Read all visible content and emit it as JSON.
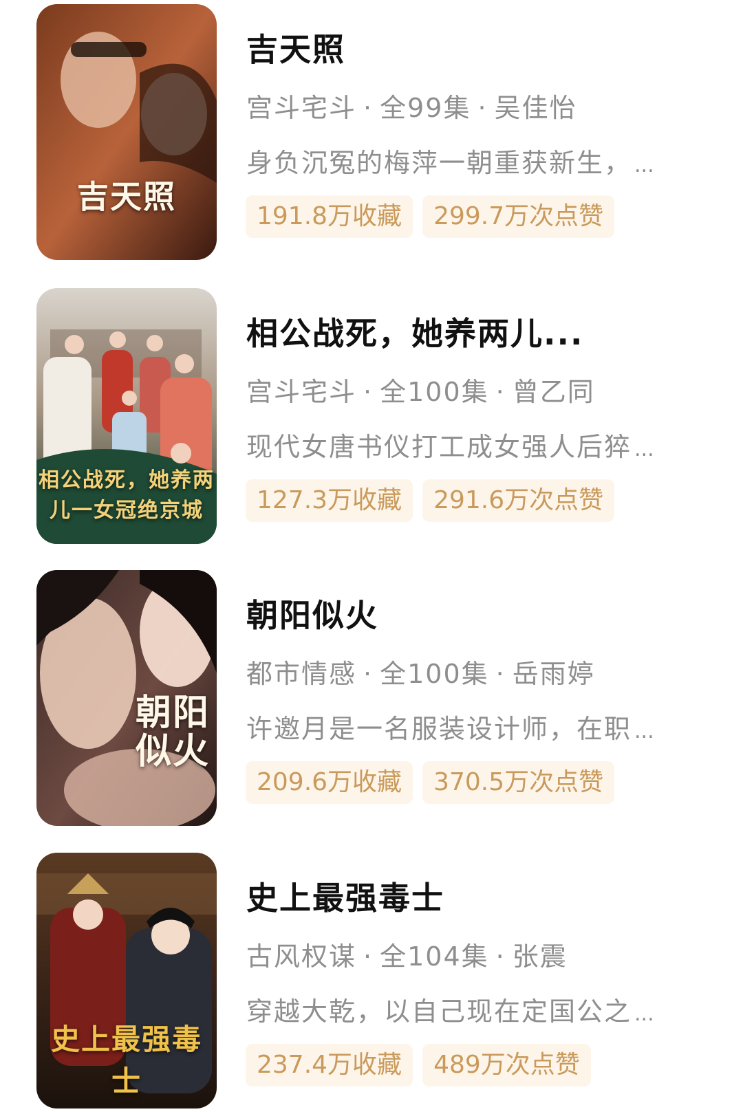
{
  "items": [
    {
      "poster_title": "吉天照",
      "title": "吉天照",
      "genre": "宫斗宅斗",
      "episodes": "全99集",
      "actor": "吴佳怡",
      "desc": "身负沉冤的梅萍一朝重获新生，",
      "ellipsis": "...",
      "favorites": "191.8万收藏",
      "likes": "299.7万次点赞"
    },
    {
      "poster_title": "相公战死，她养两儿一女冠绝京城",
      "title": "相公战死，她养两儿...",
      "genre": "宫斗宅斗",
      "episodes": "全100集",
      "actor": "曾乙同",
      "desc": "现代女唐书仪打工成女强人后猝",
      "ellipsis": "...",
      "favorites": "127.3万收藏",
      "likes": "291.6万次点赞"
    },
    {
      "poster_title": "朝阳似火",
      "title": "朝阳似火",
      "genre": "都市情感",
      "episodes": "全100集",
      "actor": "岳雨婷",
      "desc": "许邀月是一名服装设计师，在职",
      "ellipsis": "...",
      "favorites": "209.6万收藏",
      "likes": "370.5万次点赞"
    },
    {
      "poster_title": "史上最强毒士",
      "title": "史上最强毒士",
      "genre": "古风权谋",
      "episodes": "全104集",
      "actor": "张震",
      "desc": "穿越大乾，以自己现在定国公之",
      "ellipsis": "...",
      "favorites": "237.4万收藏",
      "likes": "489万次点赞"
    }
  ]
}
